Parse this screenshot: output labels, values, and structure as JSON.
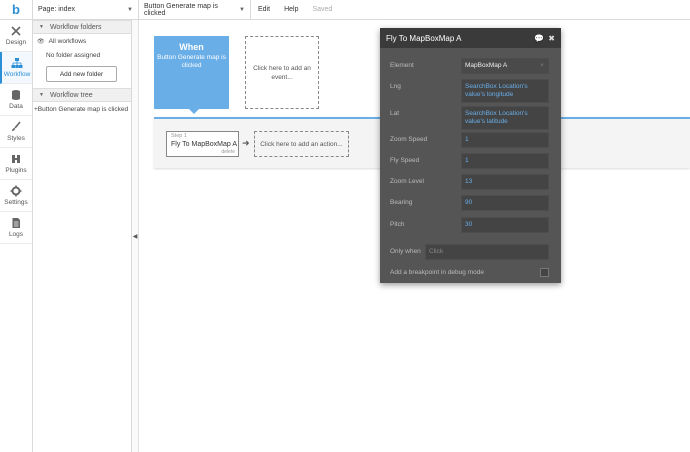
{
  "topbar": {
    "logo": "b",
    "page_select": "Page: index",
    "workflow_select": "Button Generate map is clicked",
    "menu": {
      "edit": "Edit",
      "help": "Help",
      "status": "Saved"
    }
  },
  "leftnav": {
    "items": [
      {
        "label": "Design",
        "icon": "design-icon",
        "active": false
      },
      {
        "label": "Workflow",
        "icon": "workflow-icon",
        "active": true
      },
      {
        "label": "Data",
        "icon": "database-icon",
        "active": false
      },
      {
        "label": "Styles",
        "icon": "brush-icon",
        "active": false
      },
      {
        "label": "Plugins",
        "icon": "plug-icon",
        "active": false
      },
      {
        "label": "Settings",
        "icon": "gear-icon",
        "active": false
      },
      {
        "label": "Logs",
        "icon": "document-icon",
        "active": false
      }
    ]
  },
  "sidepanel": {
    "folders_header": "Workflow folders",
    "all_workflows": "All workflows",
    "no_folder": "No folder assigned",
    "add_folder": "Add new folder",
    "tree_header": "Workflow tree",
    "tree_item": "+Button Generate map is clicked"
  },
  "canvas": {
    "when_title": "When",
    "when_event": "Button Generate map is clicked",
    "add_event": "Click here to add an event...",
    "step_label": "Step 1",
    "step_title": "Fly To MapBoxMap A",
    "step_delete": "delete",
    "add_action": "Click here to add an action..."
  },
  "panel": {
    "title": "Fly To MapBoxMap A",
    "fields": {
      "element": {
        "label": "Element",
        "value": "MapBoxMap A"
      },
      "lng": {
        "label": "Lng",
        "value": "SearchBox Location's value's longitude"
      },
      "lat": {
        "label": "Lat",
        "value": "SearchBox Location's value's latitude"
      },
      "zoom_speed": {
        "label": "Zoom Speed",
        "value": "1"
      },
      "fly_speed": {
        "label": "Fly Speed",
        "value": "1"
      },
      "zoom_level": {
        "label": "Zoom Level",
        "value": "13"
      },
      "bearing": {
        "label": "Bearing",
        "value": "90"
      },
      "pitch": {
        "label": "Pitch",
        "value": "30"
      }
    },
    "only_when": {
      "label": "Only when",
      "placeholder": "Click"
    },
    "breakpoint": "Add a breakpoint in debug mode"
  }
}
